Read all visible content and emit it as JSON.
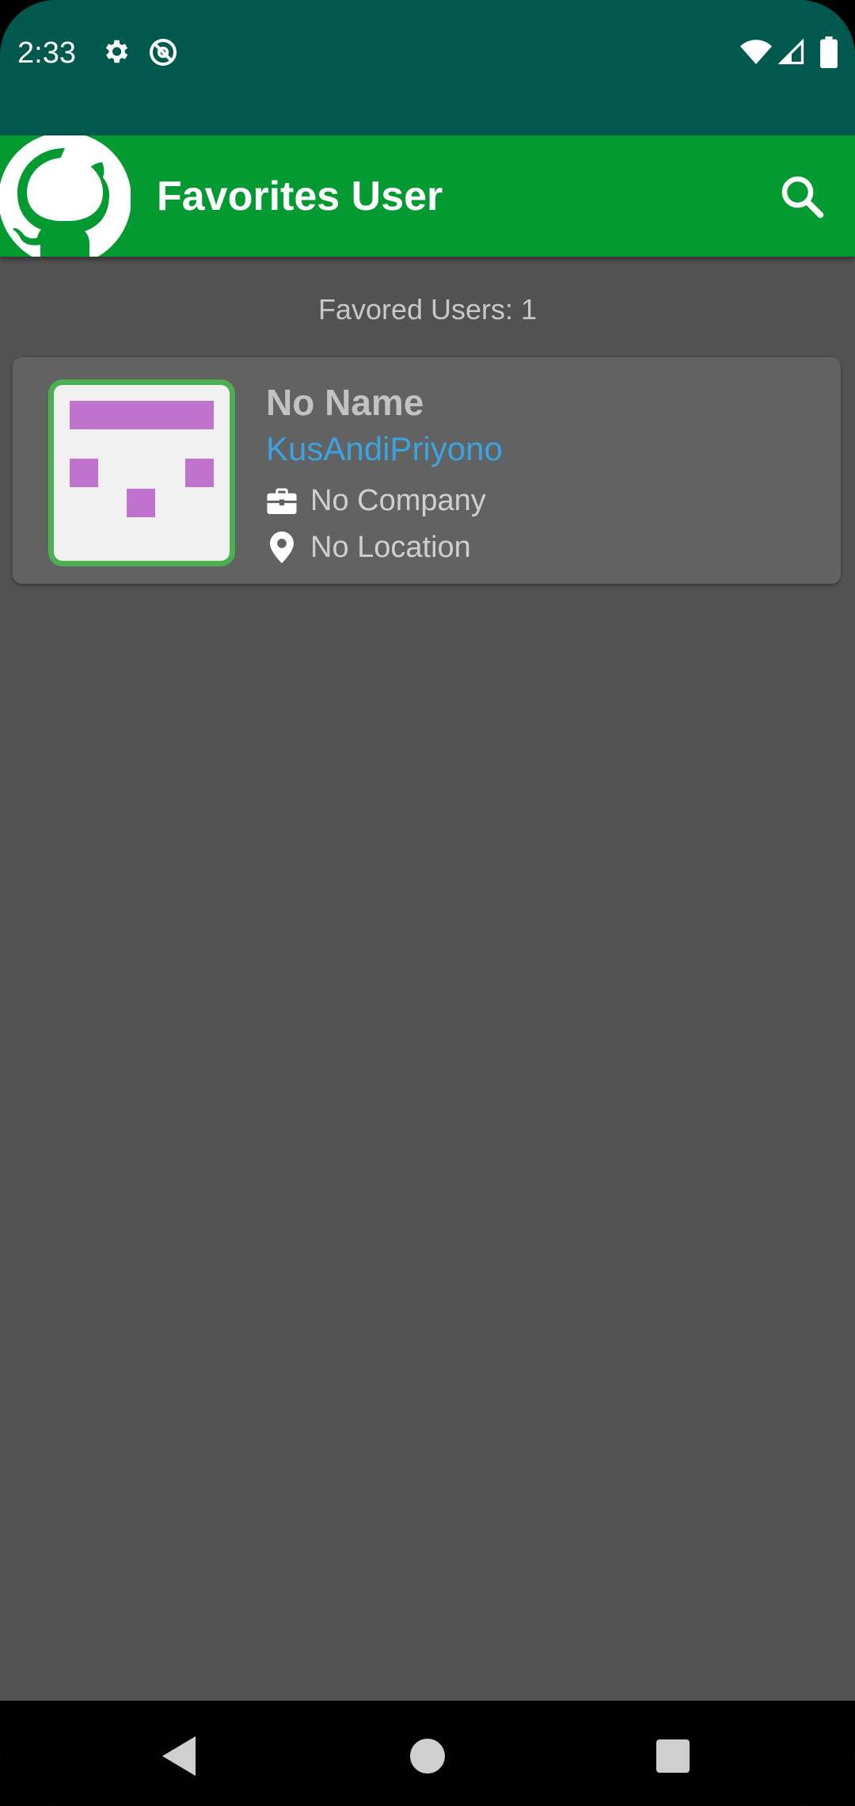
{
  "status_bar": {
    "time": "2:33",
    "icons": [
      "gear-icon",
      "no-disturb-icon",
      "wifi-icon",
      "signal-icon",
      "battery-icon"
    ]
  },
  "app_bar": {
    "logo_icon": "github-octocat-icon",
    "title": "Favorites User",
    "search_icon": "search-icon"
  },
  "content": {
    "count_label": "Favored Users: 1",
    "users": [
      {
        "name": "No Name",
        "login": "KusAndiPriyono",
        "company": "No Company",
        "location": "No Location",
        "company_icon": "briefcase-icon",
        "location_icon": "location-pin-icon"
      }
    ]
  },
  "nav_bar": {
    "icons": [
      "back-icon",
      "home-icon",
      "recents-icon"
    ]
  },
  "colors": {
    "status_bar": "#01584f",
    "app_bar": "#039a32",
    "background": "#525252",
    "card": "#626262",
    "login_link": "#3aa4e0",
    "avatar_border": "#4caf50",
    "identicon": "#bf73cd"
  }
}
